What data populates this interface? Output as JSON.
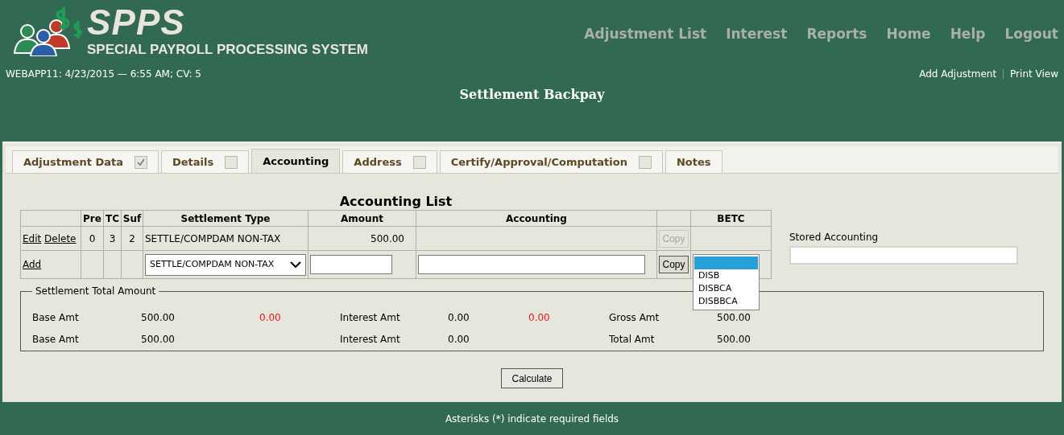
{
  "header": {
    "logo_title": "SPPS",
    "logo_subtitle": "SPECIAL PAYROLL PROCESSING SYSTEM",
    "nav": [
      "Adjustment List",
      "Interest",
      "Reports",
      "Home",
      "Help",
      "Logout"
    ],
    "info": "WEBAPP11: 4/23/2015 — 6:55 AM; CV: 5",
    "links": [
      "Add Adjustment",
      "Print View"
    ],
    "page_title": "Settlement Backpay"
  },
  "tabs": [
    {
      "label": "Adjustment Data",
      "kind": "checkbox",
      "checked": true,
      "selected": false
    },
    {
      "label": "Details",
      "kind": "checkbox",
      "checked": false,
      "selected": false
    },
    {
      "label": "Accounting",
      "kind": "plain",
      "selected": true
    },
    {
      "label": "Address",
      "kind": "checkbox",
      "checked": false,
      "selected": false
    },
    {
      "label": "Certify/Approval/Computation",
      "kind": "checkbox",
      "checked": false,
      "selected": false
    },
    {
      "label": "Notes",
      "kind": "plain",
      "selected": false
    }
  ],
  "accounting_list": {
    "title": "Accounting List",
    "columns": [
      "Pre",
      "TC",
      "Suf",
      "Settlement Type",
      "Amount",
      "Accounting",
      "BETC"
    ],
    "rows": [
      {
        "kind": "entry",
        "actions": [
          "Edit",
          "Delete"
        ],
        "pre": "0",
        "tc": "3",
        "suf": "2",
        "settlement_type": "SETTLE/COMPDAM NON-TAX",
        "amount": "500.00",
        "copy": {
          "label": "Copy",
          "disabled": true
        }
      },
      {
        "kind": "add",
        "actions": [
          "Add"
        ],
        "settlement_type": "SETTLE/COMPDAM NON-TAX",
        "copy": {
          "label": "Copy",
          "disabled": false
        },
        "betc_options": [
          {
            "selected": true
          },
          {
            "label": "DISB",
            "selected": false
          },
          {
            "label": "DISBCA",
            "selected": false
          },
          {
            "label": "DISBBCA",
            "selected": false
          }
        ]
      }
    ]
  },
  "stored_accounting": {
    "label": "Stored Accounting"
  },
  "settlement_total": {
    "legend": "Settlement Total Amount",
    "rows": [
      [
        {
          "label": "Base Amt",
          "value": "500.00",
          "diff": "0.00"
        },
        {
          "label": "Interest Amt",
          "value": "0.00",
          "diff": "0.00"
        },
        {
          "label": "Gross Amt",
          "value": "500.00"
        }
      ],
      [
        {
          "label": "Base Amt",
          "value": "500.00"
        },
        {
          "label": "Interest Amt",
          "value": "0.00"
        },
        {
          "label": "Total Amt",
          "value": "500.00"
        }
      ]
    ]
  },
  "calculate_button": "Calculate",
  "footer": "Asterisks (*) indicate required fields"
}
